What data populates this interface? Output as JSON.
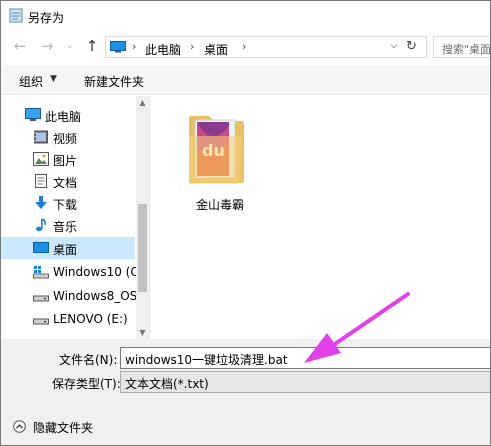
{
  "window": {
    "title": "另存为"
  },
  "address": {
    "crumbs": [
      "此电脑",
      "桌面"
    ]
  },
  "search": {
    "placeholder": "搜索\"桌面"
  },
  "toolbar": {
    "organize_label": "组织",
    "new_folder_label": "新建文件夹"
  },
  "sidebar": {
    "items": [
      {
        "label": "此电脑",
        "icon": "computer-icon"
      },
      {
        "label": "视频",
        "icon": "video-icon"
      },
      {
        "label": "图片",
        "icon": "picture-icon"
      },
      {
        "label": "文档",
        "icon": "document-icon"
      },
      {
        "label": "下载",
        "icon": "download-icon"
      },
      {
        "label": "音乐",
        "icon": "music-icon"
      },
      {
        "label": "桌面",
        "icon": "desktop-icon",
        "selected": true
      },
      {
        "label": "Windows10 (C:",
        "icon": "drive-icon"
      },
      {
        "label": "Windows8_OS",
        "icon": "drive-icon"
      },
      {
        "label": "LENOVO (E:)",
        "icon": "drive-icon"
      }
    ]
  },
  "files": [
    {
      "name": "金山毒霸",
      "icon": "folder-icon"
    }
  ],
  "form": {
    "filename_label": "文件名(N):",
    "filename_value": "windows10一键垃圾清理.bat",
    "filetype_label": "保存类型(T):",
    "filetype_value": "文本文档(*.txt)"
  },
  "footer": {
    "hide_folders_label": "隐藏文件夹"
  },
  "colors": {
    "selection": "#cce8ff",
    "accent": "#0078d7",
    "arrow": "#e040e8"
  }
}
